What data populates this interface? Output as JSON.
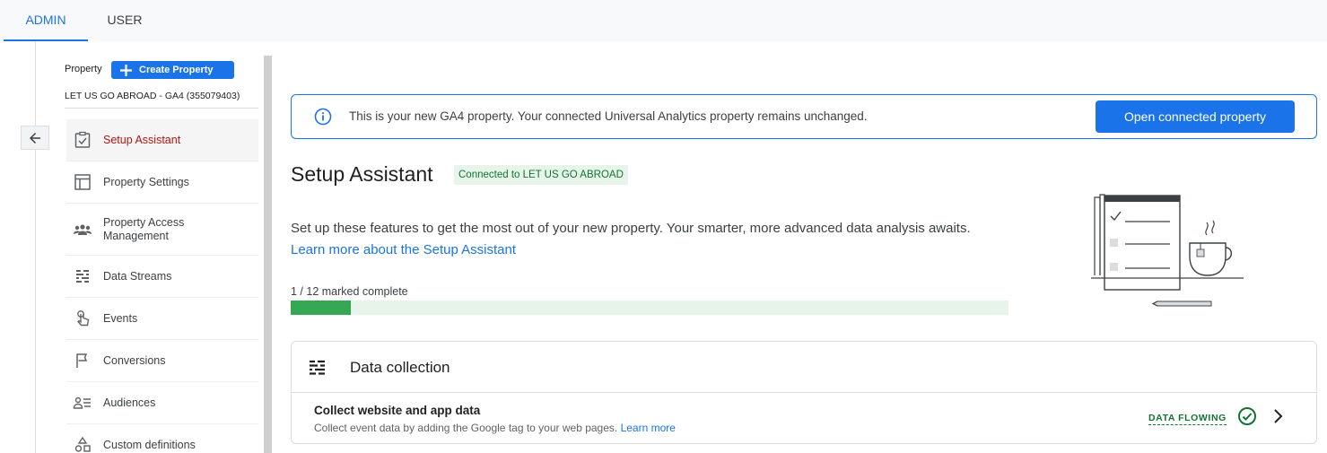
{
  "tabs": [
    {
      "label": "ADMIN",
      "active": true
    },
    {
      "label": "USER",
      "active": false
    }
  ],
  "property": {
    "label": "Property",
    "create_label": "Create Property",
    "name": "LET US GO ABROAD - GA4 (355079403)"
  },
  "nav": {
    "items": [
      {
        "label": "Setup Assistant",
        "icon": "clipboard-check-icon",
        "active": true
      },
      {
        "label": "Property Settings",
        "icon": "layout-icon"
      },
      {
        "label": "Property Access Management",
        "icon": "people-icon"
      },
      {
        "label": "Data Streams",
        "icon": "streams-icon"
      },
      {
        "label": "Events",
        "icon": "touch-icon"
      },
      {
        "label": "Conversions",
        "icon": "flag-icon"
      },
      {
        "label": "Audiences",
        "icon": "audience-icon"
      },
      {
        "label": "Custom definitions",
        "icon": "shapes-icon"
      }
    ]
  },
  "banner": {
    "text": "This is your new GA4 property. Your connected Universal Analytics property remains unchanged.",
    "button_label": "Open connected property"
  },
  "main": {
    "title": "Setup Assistant",
    "chip": "Connected to LET US GO ABROAD",
    "description": "Set up these features to get the most out of your new property. Your smarter, more advanced data analysis awaits.",
    "learn_more": "Learn more about the Setup Assistant",
    "progress_label": "1 / 12 marked complete",
    "progress_fraction": 0.0833
  },
  "card": {
    "title": "Data collection",
    "row_title": "Collect website and app data",
    "row_subtitle": "Collect event data by adding the Google tag to your web pages.",
    "row_link": "Learn more",
    "status": "DATA FLOWING"
  },
  "colors": {
    "accent": "#1a73e8",
    "success": "#34a853",
    "success_dark": "#137333",
    "active_nav": "#b31412"
  }
}
